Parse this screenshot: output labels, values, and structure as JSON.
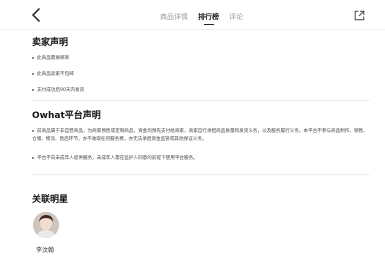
{
  "header": {
    "tabs": [
      {
        "label": "商品详情",
        "active": false
      },
      {
        "label": "排行榜",
        "active": true
      },
      {
        "label": "评论",
        "active": false
      }
    ]
  },
  "seller_statement": {
    "title": "卖家声明",
    "items": [
      "此商品需要邮寄",
      "此商品卖家不包邮",
      "支付成功后90天内发货"
    ]
  },
  "owhat_statement": {
    "title": "Owhat平台声明",
    "items": [
      "前商品属于非自营商品，为商家预售或定制商品，资金均预先支付给商家，商家自行承担商品质量和发货义务，以及服务履行义务。本平台不参与商品制作、销售、仓储、物流、售后环节，亦不收取任何服务费，亦无法承担资金监管或其他保证义务。",
      "平台不向未成年人提供服务，未成年人需在监护人同意的前提下使用平台服务。"
    ]
  },
  "related_stars": {
    "title": "关联明星",
    "stars": [
      {
        "name": "李汶翰"
      }
    ]
  },
  "colors": {
    "text_primary": "#222222",
    "text_secondary": "#999999",
    "divider": "#eeeeee"
  }
}
